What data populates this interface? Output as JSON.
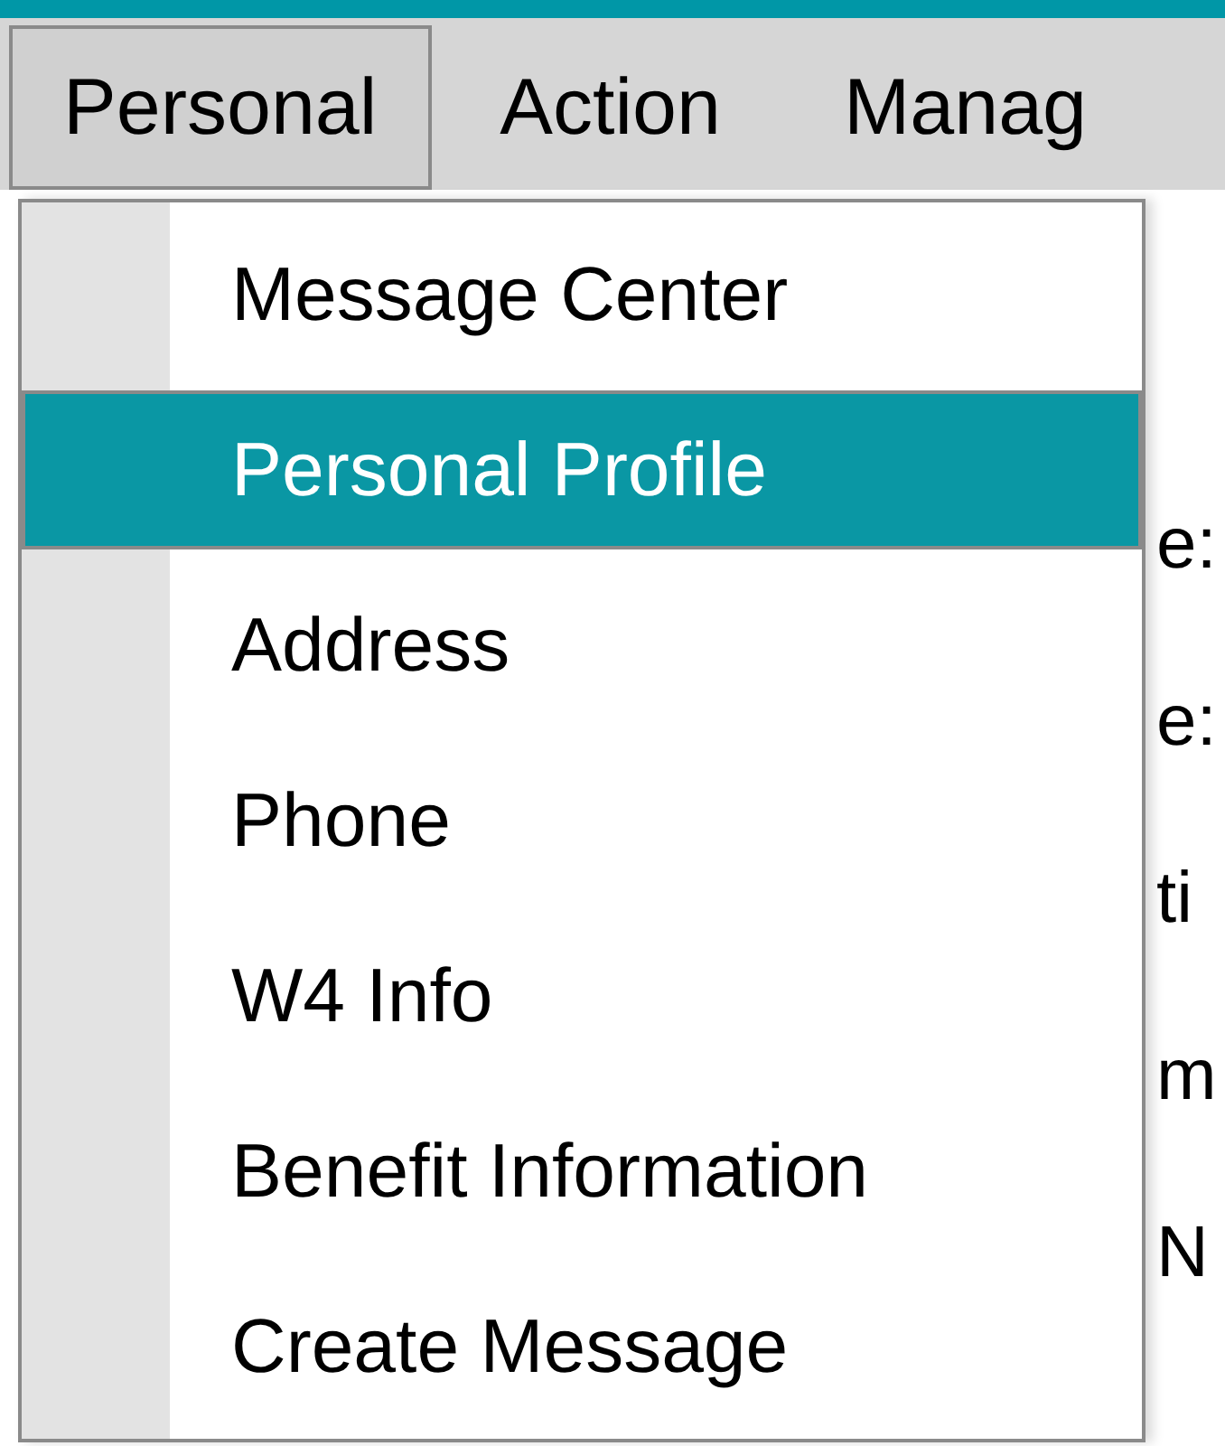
{
  "menu_bar": [
    {
      "label": "Personal",
      "selected": true
    },
    {
      "label": "Action",
      "selected": false
    },
    {
      "label": "Manag",
      "selected": false
    }
  ],
  "dropdown": {
    "items": [
      {
        "label": "Message Center",
        "selected": false
      },
      {
        "label": "Personal Profile",
        "selected": true
      },
      {
        "label": "Address",
        "selected": false
      },
      {
        "label": "Phone",
        "selected": false
      },
      {
        "label": "W4 Info",
        "selected": false
      },
      {
        "label": "Benefit Information",
        "selected": false
      },
      {
        "label": "Create Message",
        "selected": false
      }
    ]
  },
  "form_labels": [
    "e:",
    "e:",
    "ti",
    "m",
    "N"
  ]
}
